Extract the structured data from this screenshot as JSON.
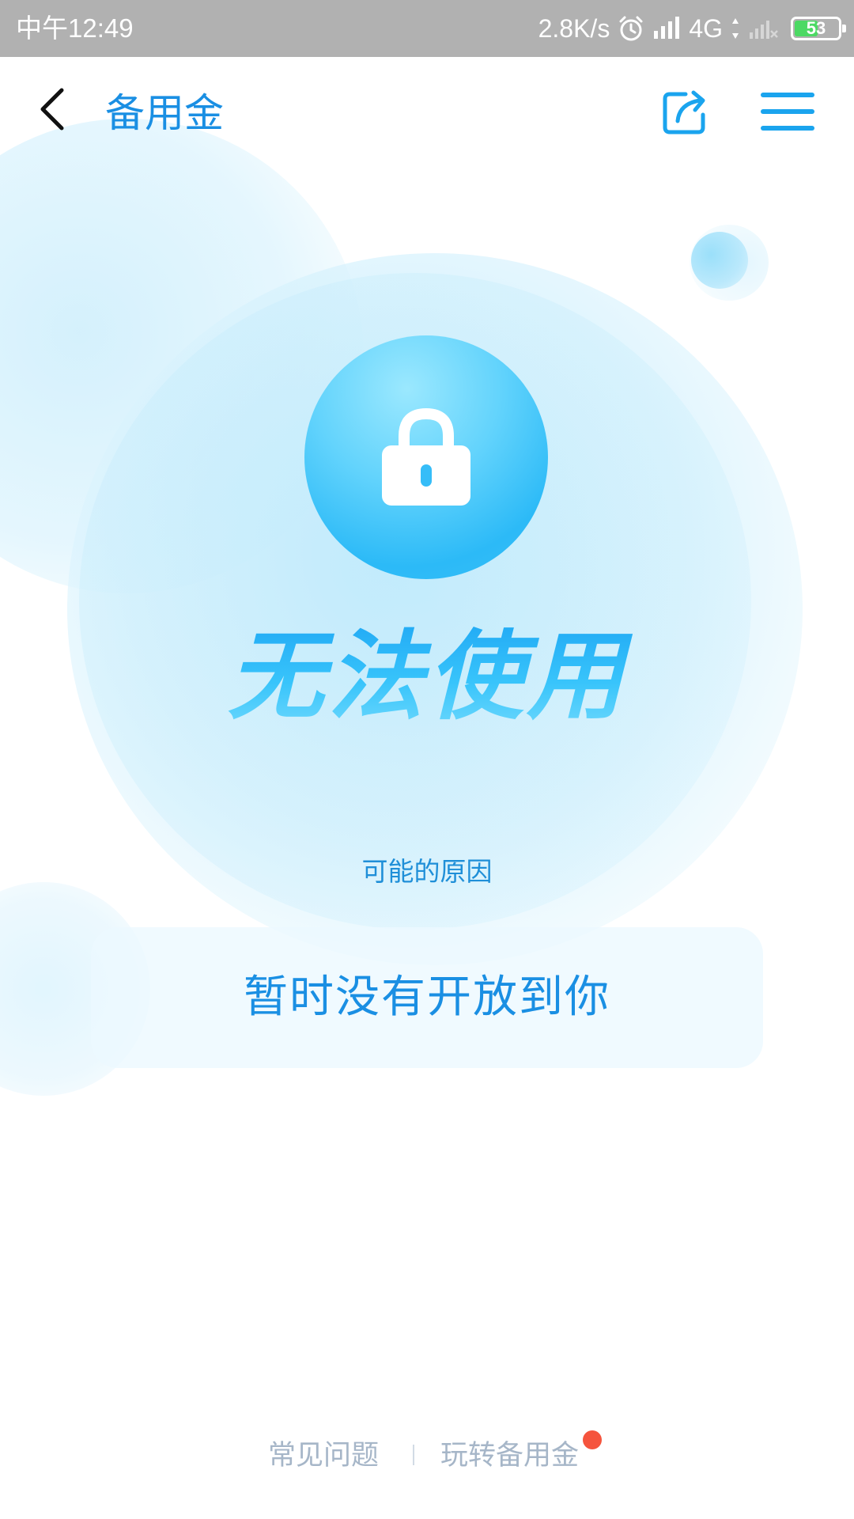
{
  "status_bar": {
    "time": "中午12:49",
    "network_speed": "2.8K/s",
    "network_type": "4G",
    "battery_level": "53",
    "battery_fraction": 0.53,
    "battery_color": "#4cd964",
    "icons": [
      "alarm-icon",
      "signal-icon",
      "data-arrows-icon",
      "no-signal-icon",
      "battery-icon"
    ]
  },
  "header": {
    "title": "备用金",
    "back_icon": "chevron-left-icon",
    "share_icon": "share-icon",
    "menu_icon": "menu-icon",
    "accent_color": "#1a8fe3"
  },
  "main": {
    "lock_icon": "lock-icon",
    "status_heading": "无法使用",
    "reason_label": "可能的原因",
    "reason_text": "暂时没有开放到你"
  },
  "footer": {
    "faq_label": "常见问题",
    "guide_label": "玩转备用金",
    "notification_dot_color": "#f5543d"
  }
}
